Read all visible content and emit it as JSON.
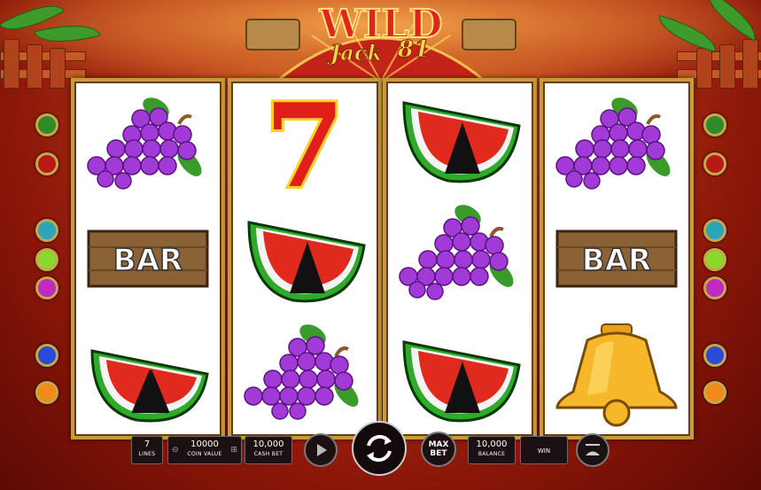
{
  "logo": {
    "line1": "WILD",
    "line2": "Jack",
    "line3": "81"
  },
  "reels": [
    [
      "grapes",
      "bar",
      "watermelon"
    ],
    [
      "seven",
      "watermelon",
      "grapes"
    ],
    [
      "watermelon",
      "grapes",
      "watermelon"
    ],
    [
      "grapes",
      "bar",
      "bell"
    ]
  ],
  "symbols": {
    "bar_text": "BAR",
    "seven_text": "7"
  },
  "controls": {
    "lines_value": "7",
    "lines_label": "LINES",
    "coin_value": "10000",
    "coin_label": "COIN VALUE",
    "cash_bet_value": "10,000",
    "cash_bet_label": "CASH BET",
    "max_bet_line1": "MAX",
    "max_bet_line2": "BET",
    "balance_value": "10,000",
    "balance_label": "BALANCE",
    "win_label": "WIN"
  },
  "colors": {
    "reel_border": "#c89a3a",
    "background": "#8a1608"
  },
  "gems_left": [
    "green",
    "red",
    "teal",
    "lime",
    "magenta",
    "blue",
    "orange"
  ],
  "gems_right": [
    "green",
    "red",
    "teal",
    "lime",
    "magenta",
    "blue",
    "orange"
  ]
}
